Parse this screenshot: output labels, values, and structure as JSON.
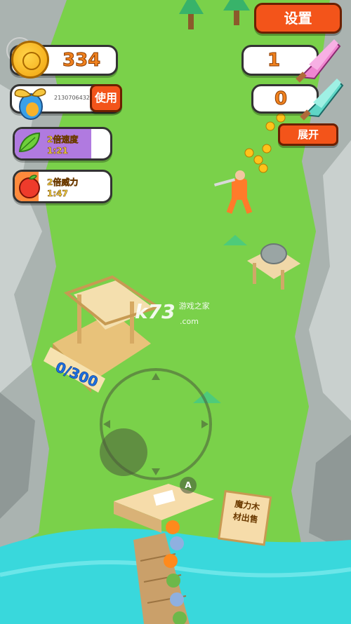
{
  "hud": {
    "settings_label": "设置",
    "coins": "334",
    "player_id": "2130706432",
    "use_label": "使用",
    "pink_wood_count": "1",
    "teal_wood_count": "0",
    "expand_label": "展开",
    "buffs": [
      {
        "title": "2倍速度",
        "time": "1:21",
        "fill_fraction": 0.8,
        "color": "#b07ae0"
      },
      {
        "title": "2倍威力",
        "time": "1:47",
        "fill_fraction": 0.25,
        "color": "#ff8a3c"
      }
    ]
  },
  "world": {
    "storage_count": "0/300",
    "shop_sign": "魔力木\n材出售",
    "button_a": "A",
    "watermark_main": "k73",
    "watermark_sub": "游戏之家",
    "watermark_url": ".com"
  },
  "colors": {
    "grass": "#7ad14a",
    "water": "#39d8dc",
    "rock": "#aab3b0",
    "orange_button": "#f3541a",
    "coin_text": "#f0821f"
  }
}
